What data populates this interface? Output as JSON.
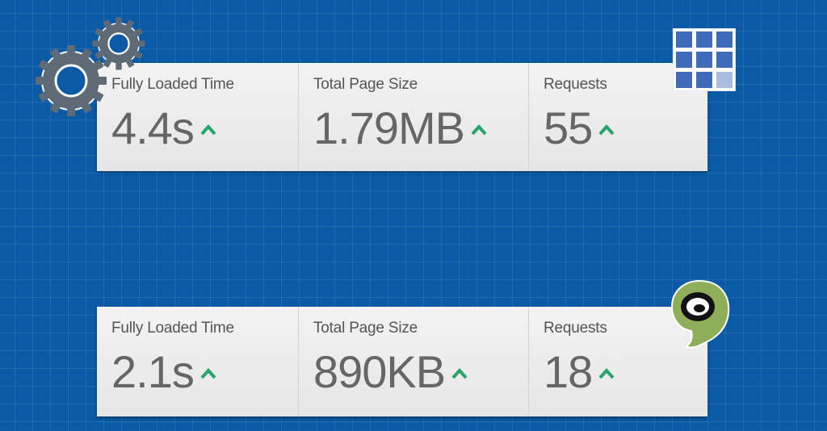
{
  "comparison": [
    {
      "fully_loaded": {
        "label": "Fully Loaded Time",
        "value": "4.4s"
      },
      "page_size": {
        "label": "Total Page Size",
        "value": "1.79MB"
      },
      "requests": {
        "label": "Requests",
        "value": "55"
      },
      "logo_icon": "blue-grid-logo-icon",
      "decoration_icon": "gears-icon"
    },
    {
      "fully_loaded": {
        "label": "Fully Loaded Time",
        "value": "2.1s"
      },
      "page_size": {
        "label": "Total Page Size",
        "value": "890KB"
      },
      "requests": {
        "label": "Requests",
        "value": "18"
      },
      "logo_icon": "green-ear-logo-icon"
    }
  ],
  "colors": {
    "background": "#0a5aa6",
    "panel": "#ececec",
    "value_text": "#666666",
    "arrow_up": "#2aa56a"
  }
}
